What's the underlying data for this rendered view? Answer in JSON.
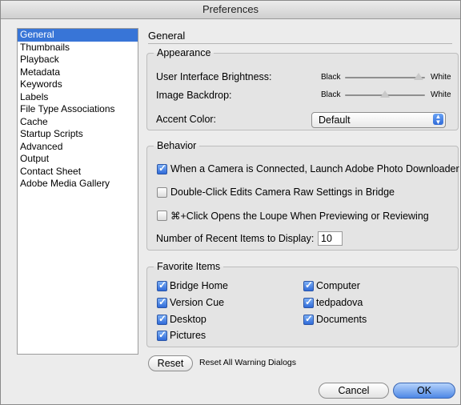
{
  "window": {
    "title": "Preferences"
  },
  "sidebar": {
    "items": [
      {
        "label": "General",
        "selected": true
      },
      {
        "label": "Thumbnails"
      },
      {
        "label": "Playback"
      },
      {
        "label": "Metadata"
      },
      {
        "label": "Keywords"
      },
      {
        "label": "Labels"
      },
      {
        "label": "File Type Associations"
      },
      {
        "label": "Cache"
      },
      {
        "label": "Startup Scripts"
      },
      {
        "label": "Advanced"
      },
      {
        "label": "Output"
      },
      {
        "label": "Contact Sheet"
      },
      {
        "label": "Adobe Media Gallery"
      }
    ]
  },
  "panel": {
    "title": "General"
  },
  "appearance": {
    "legend": "Appearance",
    "ui_brightness_label": "User Interface Brightness:",
    "image_backdrop_label": "Image Backdrop:",
    "black_label": "Black",
    "white_label": "White",
    "ui_brightness_level": 0.92,
    "image_backdrop_level": 0.5,
    "accent_color_label": "Accent Color:",
    "accent_color_value": "Default"
  },
  "behavior": {
    "legend": "Behavior",
    "launch_downloader": {
      "label": "When a Camera is Connected, Launch Adobe Photo Downloader",
      "checked": true
    },
    "double_click": {
      "label": "Double-Click Edits Camera Raw Settings in Bridge",
      "checked": false
    },
    "cmd_click": {
      "label": "⌘+Click Opens the Loupe When Previewing or Reviewing",
      "checked": false
    },
    "recent_items_label": "Number of Recent Items to Display:",
    "recent_items_value": "10"
  },
  "favorites": {
    "legend": "Favorite Items",
    "items": [
      {
        "label": "Bridge Home",
        "checked": true
      },
      {
        "label": "Version Cue",
        "checked": true
      },
      {
        "label": "Desktop",
        "checked": true
      },
      {
        "label": "Pictures",
        "checked": true
      },
      {
        "label": "Computer",
        "checked": true
      },
      {
        "label": "tedpadova",
        "checked": true
      },
      {
        "label": "Documents",
        "checked": true
      }
    ]
  },
  "footer": {
    "reset_label": "Reset",
    "reset_warning_label": "Reset All Warning Dialogs",
    "cancel_label": "Cancel",
    "ok_label": "OK"
  },
  "colors": {
    "selection": "#3875d7",
    "accent_blue": "#2f6ad8"
  }
}
